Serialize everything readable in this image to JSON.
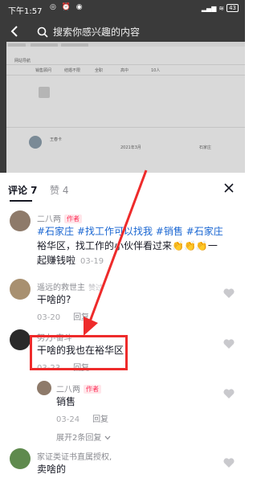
{
  "status_bar": {
    "time": "下午1:57",
    "battery": "43"
  },
  "top_bar": {
    "search_placeholder": "搜索你感兴趣的内容"
  },
  "background_frame": {
    "tab_row": "网站导航",
    "table_headers": [
      "销售顾问",
      "结婚不限",
      "全职",
      "高中",
      "10人"
    ],
    "profile_name": "王春卡",
    "profile_date": "2021年3月",
    "profile_location": "石家庄"
  },
  "sheet": {
    "tabs": {
      "comments": "评论 7",
      "likes": "赞 4"
    },
    "comments": [
      {
        "user": "二八两",
        "badge": "作者",
        "hashtags": [
          "#石家庄",
          "#找工作可以找我",
          "#销售",
          "#石家庄"
        ],
        "text_line2": "裕华区，找工作的小伙伴看过来",
        "text_line2_emoji": "👏👏👏",
        "text_line2_tail": "一",
        "text_line3": "起赚钱啦",
        "date": "03-19"
      },
      {
        "user": "遥远的救世主",
        "badge": "赞过",
        "text": "干啥的?",
        "date": "03-20",
        "reply_label": "回复"
      },
      {
        "user": "努力-奋斗",
        "text": "干啥的我也在裕华区",
        "date": "03-23",
        "reply_label": "回复"
      },
      {
        "user": "二八两",
        "badge": "作者",
        "text": "销售",
        "date": "03-24",
        "reply_label": "回复"
      },
      {
        "user": "家证类证书直属授权,",
        "text": "卖啥的"
      }
    ],
    "expand_replies": "展开2条回复"
  },
  "colors": {
    "accent": "#fe2c55",
    "hashtag": "#1966d2",
    "annotation": "#ee2b2b"
  }
}
